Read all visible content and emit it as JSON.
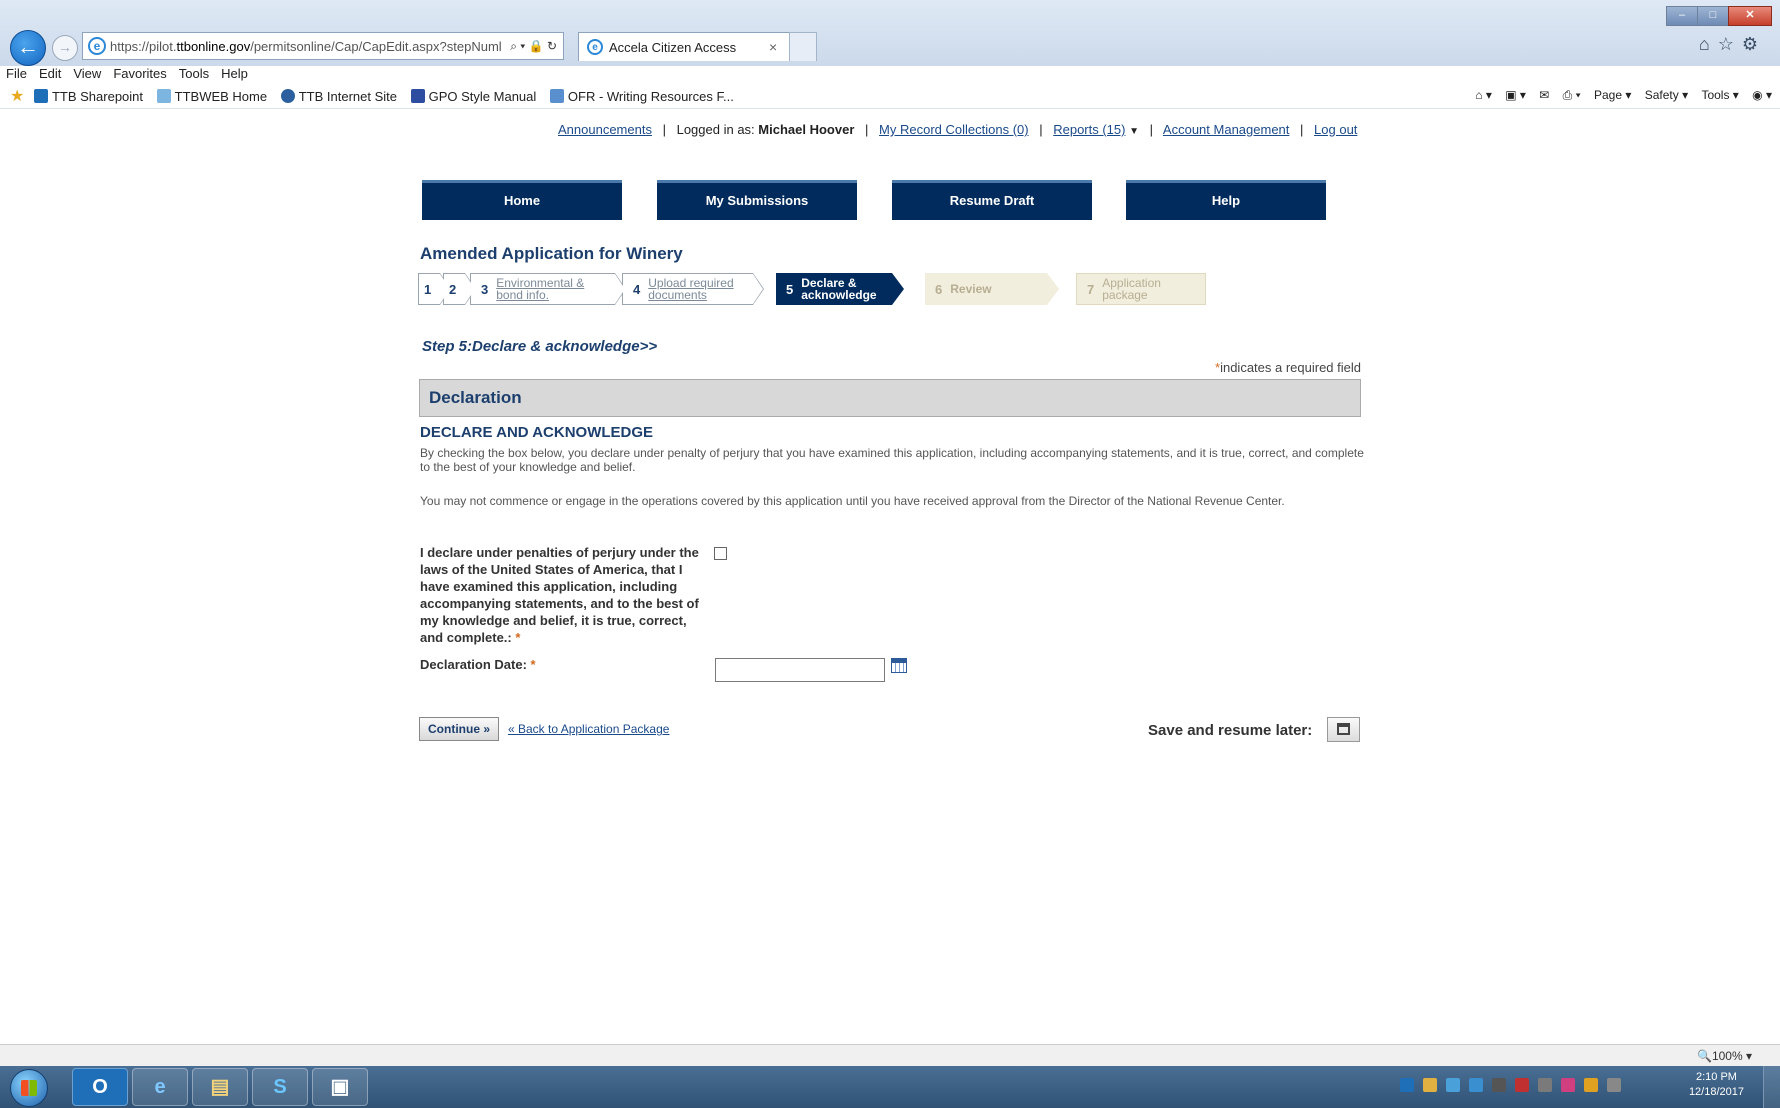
{
  "browser": {
    "url_prefix": "https://pilot.",
    "url_domain": "ttbonline.gov",
    "url_path": "/permitsonline/Cap/CapEdit.aspx?stepNuml",
    "address_icons": "⌕ ▾ 🔒 ↻",
    "tab_title": "Accela Citizen Access",
    "tab_close": "×",
    "back_glyph": "←",
    "forward_glyph": "→",
    "right_icons": "⌂☆⚙",
    "window_controls": [
      "–",
      "□",
      "✕"
    ]
  },
  "menu": [
    "File",
    "Edit",
    "View",
    "Favorites",
    "Tools",
    "Help"
  ],
  "favorites": [
    {
      "label": "TTB Sharepoint",
      "color": "#1f6fb8"
    },
    {
      "label": "TTBWEB Home",
      "color": "#7bb5e0"
    },
    {
      "label": "TTB Internet Site",
      "color": "#2b5f9e"
    },
    {
      "label": "GPO Style Manual",
      "color": "#2d4ea0"
    },
    {
      "label": "OFR - Writing Resources F...",
      "color": "#5a8fcf"
    }
  ],
  "command_bar": [
    "⌂ ▾",
    "▣ ▾",
    "✉",
    "⎙ ▾",
    "Page ▾",
    "Safety ▾",
    "Tools ▾",
    "◉ ▾"
  ],
  "top_links": {
    "announcements": "Announcements",
    "logged_in_prefix": "Logged in as:",
    "user_name": "Michael Hoover",
    "record_collections": "My Record Collections (0)",
    "reports": "Reports (15)",
    "reports_caret": "▼",
    "account": "Account Management",
    "logout": "Log out",
    "separator": "|"
  },
  "nav": {
    "home": "Home",
    "submissions": "My Submissions",
    "resume": "Resume Draft",
    "help": "Help"
  },
  "app_title": "Amended Application for Winery",
  "steps": [
    {
      "num": "1",
      "label": ""
    },
    {
      "num": "2",
      "label": ""
    },
    {
      "num": "3",
      "label": "Environmental & bond info."
    },
    {
      "num": "4",
      "label": "Upload required documents"
    },
    {
      "num": "5",
      "label": "Declare & acknowledge"
    },
    {
      "num": "6",
      "label": "Review"
    },
    {
      "num": "7",
      "label": "Application package"
    }
  ],
  "step_heading": "Step 5:Declare & acknowledge>>",
  "required_note": {
    "asterisk": "*",
    "text": "indicates a required field"
  },
  "section_title": "Declaration",
  "declare_title": "DECLARE AND ACKNOWLEDGE",
  "para1": "By checking the box below, you declare under penalty of perjury that you have examined this application, including accompanying statements, and it is true, correct, and complete to the best of your knowledge and belief.",
  "para2": "You may not commence or engage in the operations covered by this application until you have received approval from the Director of the National Revenue Center.",
  "declaration_label": "I declare under penalties of perjury under the laws of the United States of America, that I have examined this application, including accompanying statements, and to the best of my knowledge and belief, it is true, correct, and complete.:",
  "asterisk": "*",
  "date_label": "Declaration Date:",
  "date_value": "",
  "continue_label": "Continue »",
  "back_link": "« Back to Application Package",
  "save_label": "Save and resume later:",
  "zoom": "🔍100%  ▾",
  "taskbar": {
    "items": [
      "O",
      "e",
      "▤",
      "S",
      "▣"
    ],
    "clock_time": "2:10 PM",
    "clock_date": "12/18/2017",
    "tray_colors": [
      "#1f6fb8",
      "#e0b040",
      "#4aa0d8",
      "#3a8fd0",
      "#555",
      "#c03030",
      "#7a7a7a",
      "#d04080",
      "#e0a020",
      "#888"
    ]
  }
}
